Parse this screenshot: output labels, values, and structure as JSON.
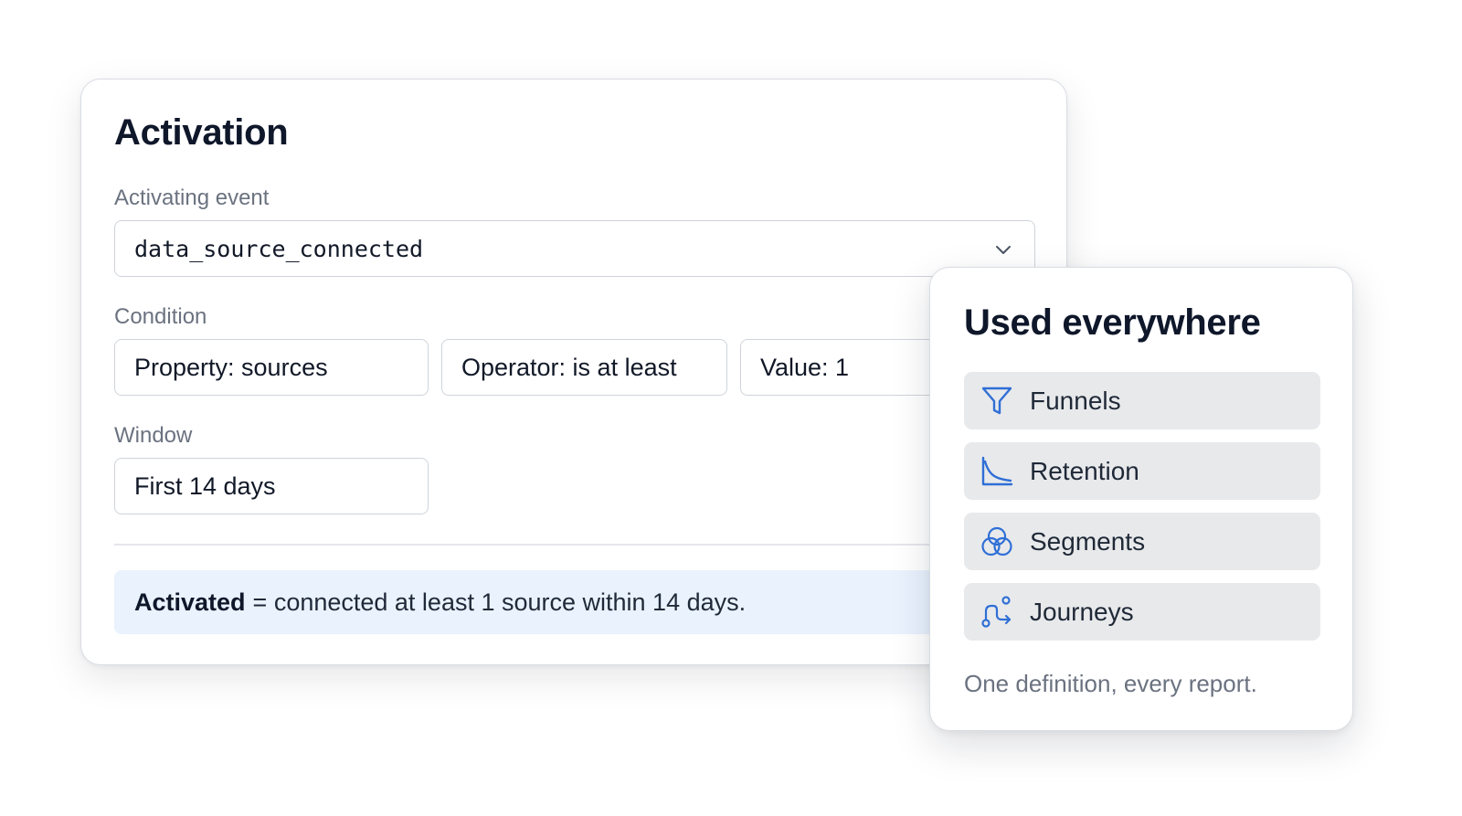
{
  "activation": {
    "title": "Activation",
    "event_label": "Activating event",
    "event_value": "data_source_connected",
    "condition_label": "Condition",
    "property": "Property: sources",
    "operator": "Operator: is at least",
    "value": "Value: 1",
    "window_label": "Window",
    "window_value": "First 14 days",
    "summary_bold": "Activated",
    "summary_text": "= connected at least 1 source within 14 days."
  },
  "used_everywhere": {
    "title": "Used everywhere",
    "items": [
      {
        "label": "Funnels",
        "icon": "funnel-icon"
      },
      {
        "label": "Retention",
        "icon": "retention-curve-icon"
      },
      {
        "label": "Segments",
        "icon": "venn-circles-icon"
      },
      {
        "label": "Journeys",
        "icon": "journey-path-icon"
      }
    ],
    "footer": "One definition, every report."
  },
  "colors": {
    "accent": "#2f6fd6",
    "summary_bg": "#e9f2fd",
    "item_bg": "#e8e9eb"
  }
}
